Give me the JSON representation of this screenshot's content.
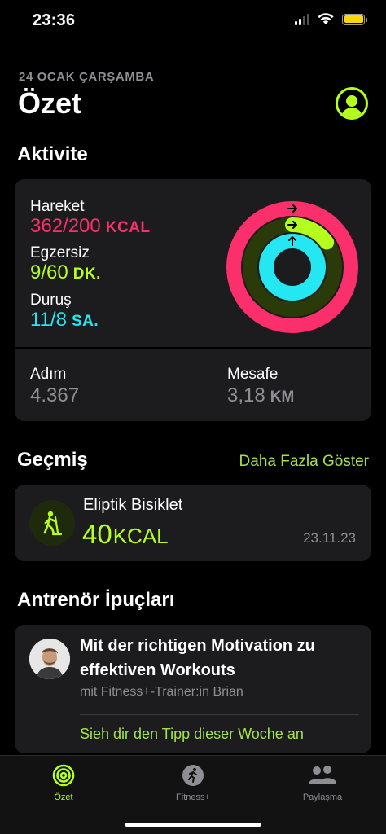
{
  "status_bar": {
    "time": "23:36",
    "battery_level": 1.0
  },
  "header": {
    "date": "24 OCAK ÇARŞAMBA",
    "title": "Özet",
    "profile_icon": "person-circle-icon"
  },
  "activity": {
    "section_title": "Aktivite",
    "move": {
      "label": "Hareket",
      "value": "362/200",
      "unit": "KCAL",
      "color": "#fa2f6b",
      "progress": 1.81
    },
    "exercise": {
      "label": "Egzersiz",
      "value": "9/60",
      "unit": "DK.",
      "color": "#b5ff1f",
      "progress": 0.15
    },
    "stand": {
      "label": "Duruş",
      "value": "11/8",
      "unit": "SA.",
      "color": "#24e7f1",
      "progress": 1.375
    },
    "steps": {
      "label": "Adım",
      "value": "4.367"
    },
    "distance": {
      "label": "Mesafe",
      "value": "3,18",
      "unit": "KM"
    }
  },
  "history": {
    "section_title": "Geçmiş",
    "show_more": "Daha Fazla Göster",
    "workout": {
      "name": "Eliptik Bisiklet",
      "value": "40",
      "unit": "KCAL",
      "date": "23.11.23",
      "icon": "elliptical-icon"
    }
  },
  "coach_tips": {
    "section_title": "Antrenör İpuçları",
    "title": "Mit der richtigen Motivation zu effektiven Workouts",
    "subtitle": "mit Fitness+-Trainer:in Brian",
    "link": "Sieh dir den Tipp dieser Woche an"
  },
  "tab_bar": {
    "tabs": [
      {
        "label": "Özet",
        "icon": "activity-rings-icon",
        "active": true
      },
      {
        "label": "Fitness+",
        "icon": "running-person-icon",
        "active": false
      },
      {
        "label": "Paylaşma",
        "icon": "people-icon",
        "active": false
      }
    ]
  },
  "colors": {
    "accent": "#b5ff1f",
    "link": "#a4e24a",
    "background": "#000000",
    "card": "#1c1c1e"
  }
}
